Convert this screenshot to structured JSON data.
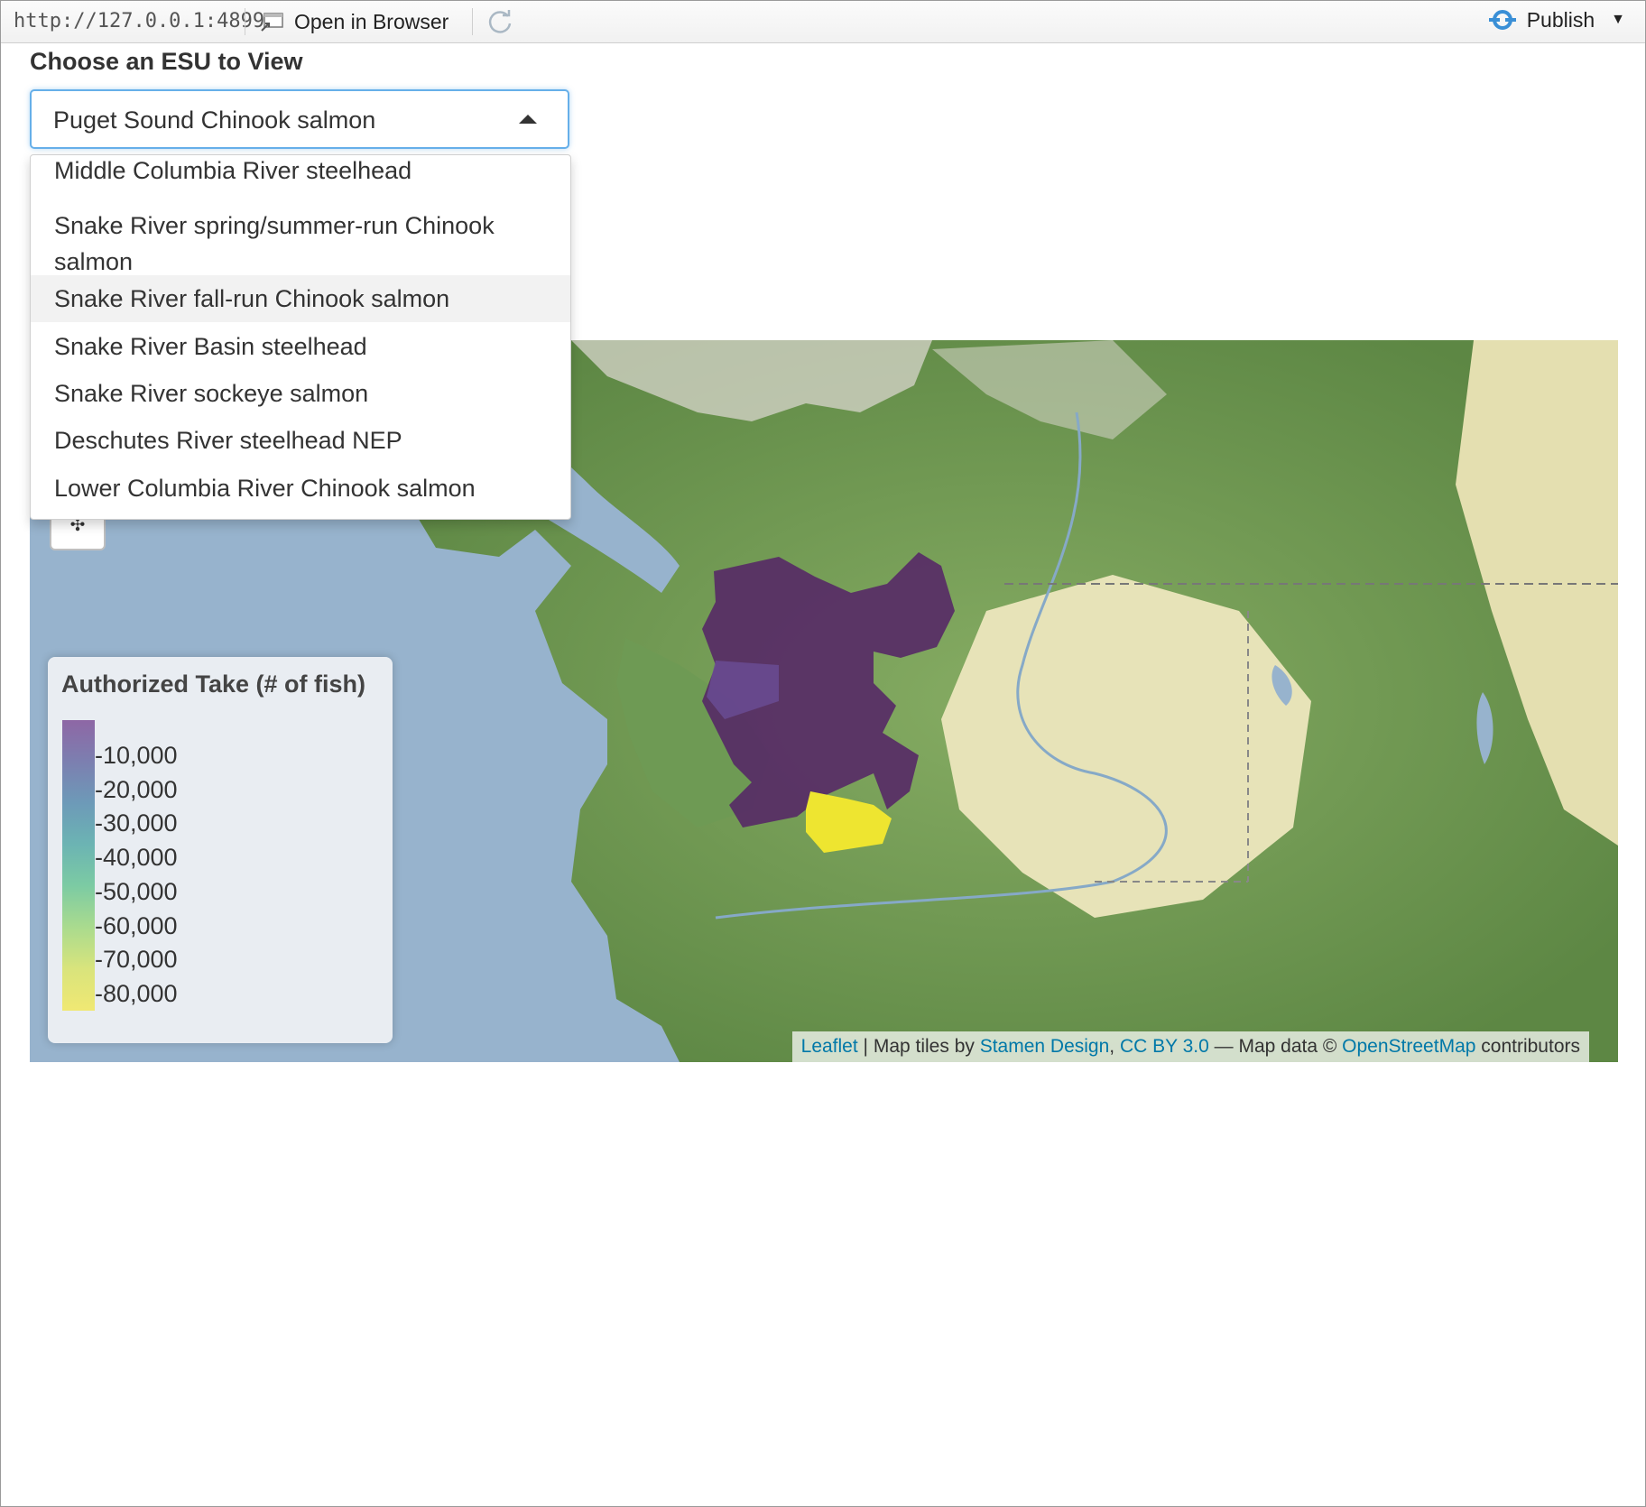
{
  "topbar": {
    "url": "http://127.0.0.1:4899",
    "open_label": "Open in Browser",
    "publish_label": "Publish"
  },
  "control": {
    "label": "Choose an ESU to View",
    "selected": "Puget Sound Chinook salmon",
    "options": [
      "Middle Columbia River steelhead",
      "Snake River spring/summer-run Chinook salmon",
      "Snake River fall-run Chinook salmon",
      "Snake River Basin steelhead",
      "Snake River sockeye salmon",
      "Deschutes River steelhead NEP",
      "Lower Columbia River Chinook salmon"
    ],
    "highlighted_index": 2
  },
  "map": {
    "zoom_in": "+",
    "zoom_out": "−",
    "legend": {
      "title": "Authorized Take (# of fish)",
      "ticks": [
        "10,000",
        "20,000",
        "30,000",
        "40,000",
        "50,000",
        "60,000",
        "70,000",
        "80,000"
      ],
      "colors": [
        "#8e67a5",
        "#7c7fb0",
        "#6d9ab8",
        "#6cb4b3",
        "#7ccba3",
        "#aadb8e",
        "#d9e47c",
        "#f0e873"
      ]
    },
    "attribution": {
      "leaflet": "Leaflet",
      "sep1": " | Map tiles by ",
      "stamen": "Stamen Design",
      "comma": ", ",
      "cc": "CC BY 3.0",
      "dash": " — Map data © ",
      "osm": "OpenStreetMap",
      "tail": " contributors"
    },
    "colors": {
      "water": "#97b3cd",
      "forest": "#6f9a52",
      "plain": "#e7e3b8",
      "mountain": "#d8d6cc",
      "region_purple": "#552566",
      "region_yellow": "#eee530"
    }
  }
}
